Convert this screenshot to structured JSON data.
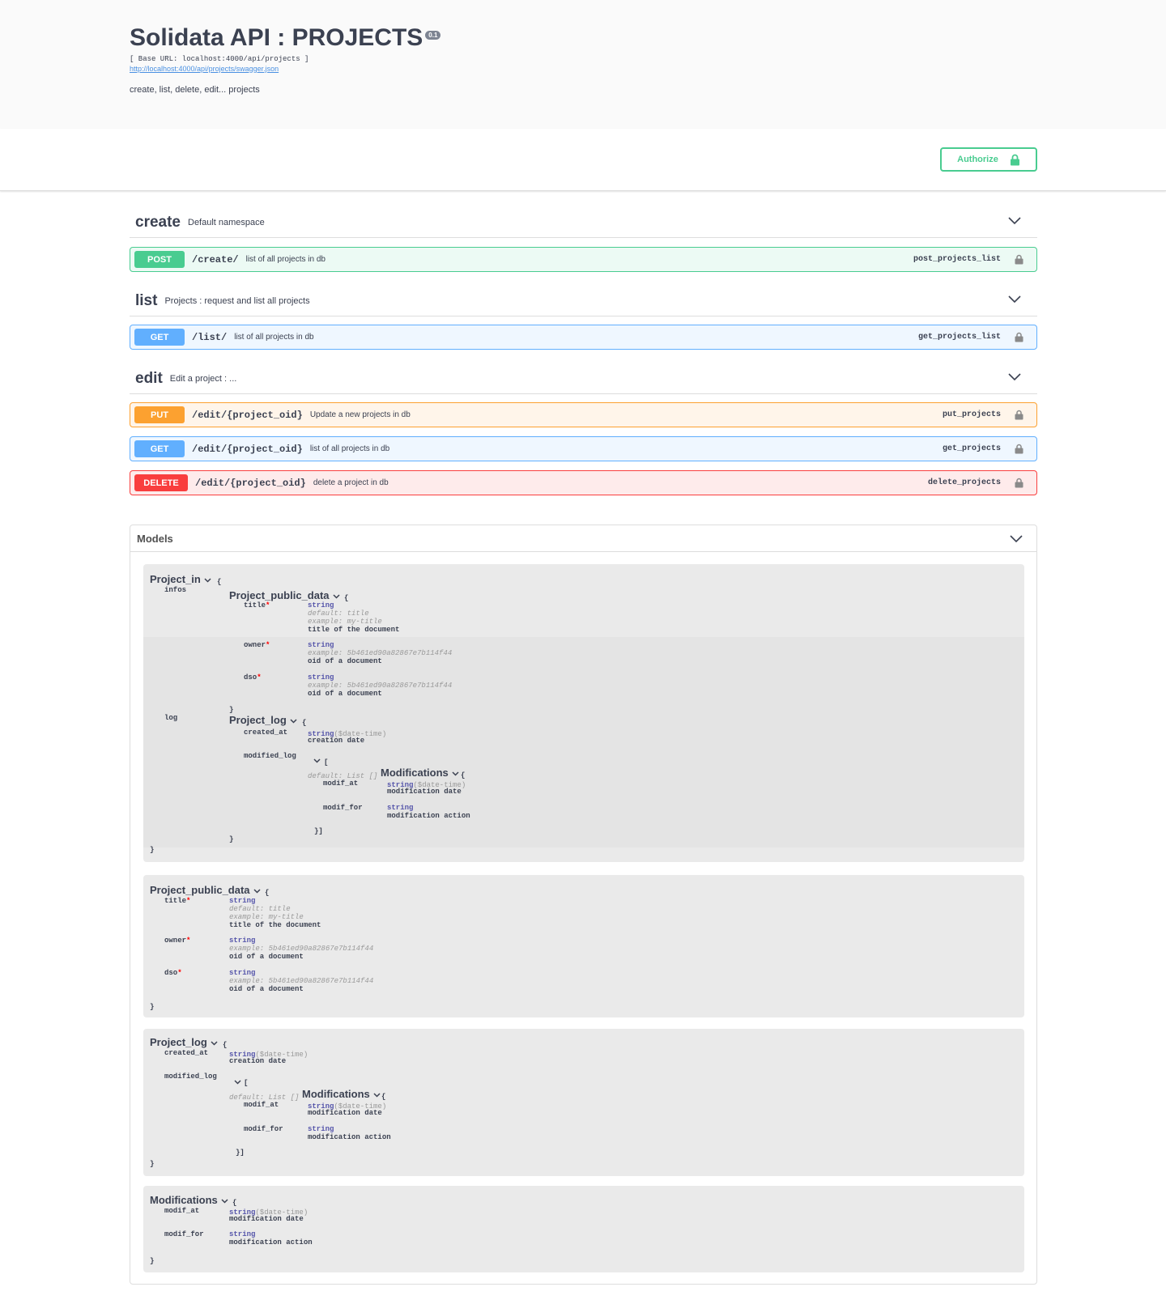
{
  "info": {
    "title": "Solidata API : PROJECTS",
    "version": "0.1",
    "base_url": "[ Base URL: localhost:4000/api/projects ]",
    "swagger_link": "http://localhost:4000/api/projects/swagger.json",
    "description": "create, list, delete, edit... projects"
  },
  "authorize": {
    "label": "Authorize",
    "icon": "lock-icon"
  },
  "tags": [
    {
      "name": "create",
      "description": "Default namespace"
    },
    {
      "name": "list",
      "description": "Projects : request and list all projects"
    },
    {
      "name": "edit",
      "description": "Edit a project : ..."
    }
  ],
  "operations": [
    {
      "method": "POST",
      "path": "/create/",
      "summary": "list of all projects in db",
      "operation_id": "post_projects_list",
      "color": "#49cc90"
    },
    {
      "method": "GET",
      "path": "/list/",
      "summary": "list of all projects in db",
      "operation_id": "get_projects_list",
      "color": "#61affe"
    },
    {
      "method": "PUT",
      "path": "/edit/{project_oid}",
      "summary": "Update a new projects in db",
      "operation_id": "put_projects",
      "color": "#fca130"
    },
    {
      "method": "GET",
      "path": "/edit/{project_oid}",
      "summary": "list of all projects in db",
      "operation_id": "get_projects",
      "color": "#61affe"
    },
    {
      "method": "DELETE",
      "path": "/edit/{project_oid}",
      "summary": "delete a project in db",
      "operation_id": "delete_projects",
      "color": "#f93e3e"
    }
  ],
  "models": {
    "heading": "Models",
    "common": {
      "open_brace": "{",
      "close_brace": "}",
      "open_bracket": "[",
      "close_list": "}]",
      "required_mark": "*",
      "string": "string",
      "datetime_format": "($date-time)",
      "default_list": "default: List []"
    },
    "project_in": {
      "name": "Project_in",
      "infos_label": "infos",
      "log_label": "log"
    },
    "project_public_data": {
      "name": "Project_public_data",
      "title_label": "title",
      "title_default": "default: title",
      "title_example": "example: my-title",
      "title_desc": "title of the document",
      "owner_label": "owner",
      "owner_example": "example: 5b461ed90a82867e7b114f44",
      "owner_desc": "oid of a document",
      "dso_label": "dso",
      "dso_example": "example: 5b461ed90a82867e7b114f44",
      "dso_desc": "oid of a document"
    },
    "project_log": {
      "name": "Project_log",
      "created_at_label": "created_at",
      "created_at_desc": "creation date",
      "modified_log_label": "modified_log"
    },
    "modifications": {
      "name": "Modifications",
      "modif_at_label": "modif_at",
      "modif_at_desc": "modification date",
      "modif_for_label": "modif_for",
      "modif_for_desc": "modification action"
    }
  }
}
